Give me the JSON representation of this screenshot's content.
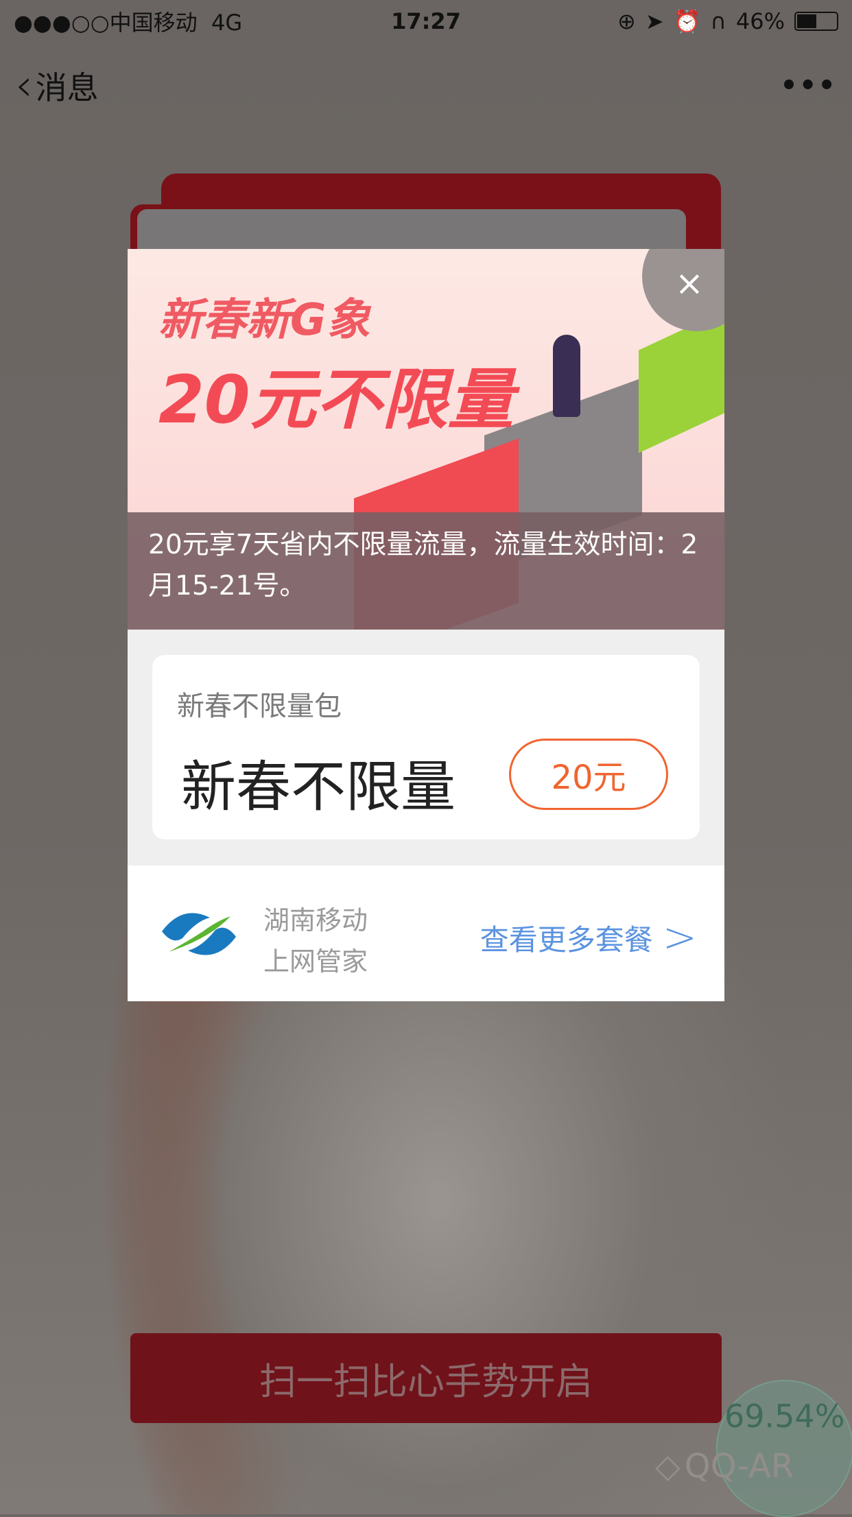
{
  "status_bar": {
    "signal": "●●●○○",
    "carrier": "中国移动",
    "network": "4G",
    "time": "17:27",
    "battery": "46%",
    "battery_level": 0.46,
    "icons": [
      "orientation-lock-icon",
      "location-icon",
      "alarm-icon",
      "headphones-icon"
    ]
  },
  "nav": {
    "back_label": "消息",
    "more": "•••"
  },
  "modal": {
    "banner": {
      "headline1": "新春新G象",
      "headline2": "20元不限量",
      "caption": "20元享7天省内不限量流量，流量生效时间：2月15-21号。",
      "close": "×"
    },
    "package": {
      "subtitle": "新春不限量包",
      "name": "新春不限量",
      "price": "20元"
    },
    "footer": {
      "brand_line1": "湖南移动",
      "brand_line2": "上网管家",
      "more_link": "查看更多套餐"
    }
  },
  "cta": {
    "label": "扫一扫比心手势开启"
  },
  "ar": {
    "progress": "69.54%",
    "label": "QQ-AR"
  },
  "colors": {
    "accent": "#f06530",
    "link": "#5b93e0",
    "cta_bg": "#701219"
  }
}
